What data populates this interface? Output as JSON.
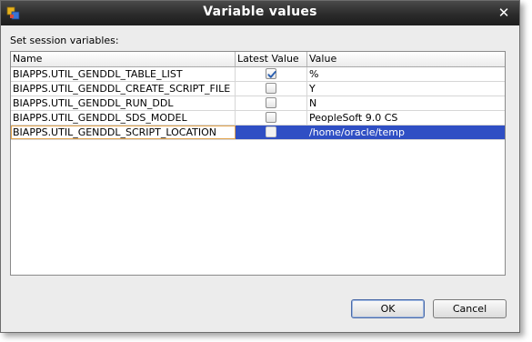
{
  "dialog": {
    "title": "Variable values",
    "close_glyph": "✕",
    "section_label": "Set session variables:"
  },
  "table": {
    "columns": [
      "Name",
      "Latest Value",
      "Value"
    ],
    "rows": [
      {
        "name": "BIAPPS.UTIL_GENDDL_TABLE_LIST",
        "latest": true,
        "value": "%"
      },
      {
        "name": "BIAPPS.UTIL_GENDDL_CREATE_SCRIPT_FILE",
        "latest": false,
        "value": "Y"
      },
      {
        "name": "BIAPPS.UTIL_GENDDL_RUN_DDL",
        "latest": false,
        "value": "N"
      },
      {
        "name": "BIAPPS.UTIL_GENDDL_SDS_MODEL",
        "latest": false,
        "value": "PeopleSoft 9.0 CS"
      },
      {
        "name": "BIAPPS.UTIL_GENDDL_SCRIPT_LOCATION",
        "latest": false,
        "value": "/home/oracle/temp",
        "selected": true
      }
    ]
  },
  "buttons": {
    "ok_label": "OK",
    "cancel_label": "Cancel"
  },
  "colors": {
    "selection": "#2f4fc4",
    "checkmark": "#2a5fb0"
  },
  "icons": {
    "app": "app-icon",
    "close": "close-icon",
    "check": "checkmark-icon"
  }
}
